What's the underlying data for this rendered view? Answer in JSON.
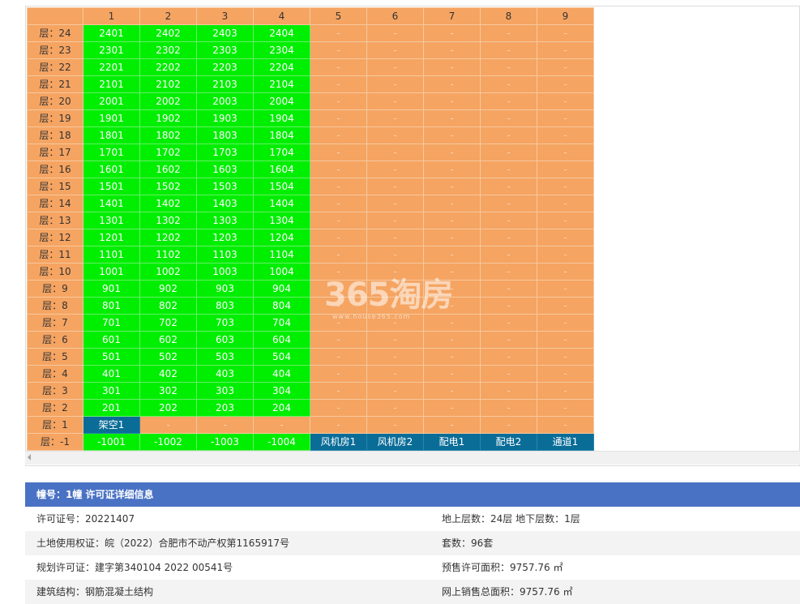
{
  "grid": {
    "columns": [
      "",
      "1",
      "2",
      "3",
      "4",
      "5",
      "6",
      "7",
      "8",
      "9"
    ],
    "rows": [
      {
        "floor": "层：24",
        "units": [
          "2401",
          "2402",
          "2403",
          "2404",
          "-",
          "-",
          "-",
          "-",
          "-"
        ],
        "kind": [
          "sold",
          "sold",
          "sold",
          "sold",
          "empty",
          "empty",
          "empty",
          "empty",
          "empty"
        ]
      },
      {
        "floor": "层：23",
        "units": [
          "2301",
          "2302",
          "2303",
          "2304",
          "-",
          "-",
          "-",
          "-",
          "-"
        ],
        "kind": [
          "sold",
          "sold",
          "sold",
          "sold",
          "empty",
          "empty",
          "empty",
          "empty",
          "empty"
        ]
      },
      {
        "floor": "层：22",
        "units": [
          "2201",
          "2202",
          "2203",
          "2204",
          "-",
          "-",
          "-",
          "-",
          "-"
        ],
        "kind": [
          "sold",
          "sold",
          "sold",
          "sold",
          "empty",
          "empty",
          "empty",
          "empty",
          "empty"
        ]
      },
      {
        "floor": "层：21",
        "units": [
          "2101",
          "2102",
          "2103",
          "2104",
          "-",
          "-",
          "-",
          "-",
          "-"
        ],
        "kind": [
          "sold",
          "sold",
          "sold",
          "sold",
          "empty",
          "empty",
          "empty",
          "empty",
          "empty"
        ]
      },
      {
        "floor": "层：20",
        "units": [
          "2001",
          "2002",
          "2003",
          "2004",
          "-",
          "-",
          "-",
          "-",
          "-"
        ],
        "kind": [
          "sold",
          "sold",
          "sold",
          "sold",
          "empty",
          "empty",
          "empty",
          "empty",
          "empty"
        ]
      },
      {
        "floor": "层：19",
        "units": [
          "1901",
          "1902",
          "1903",
          "1904",
          "-",
          "-",
          "-",
          "-",
          "-"
        ],
        "kind": [
          "sold",
          "sold",
          "sold",
          "sold",
          "empty",
          "empty",
          "empty",
          "empty",
          "empty"
        ]
      },
      {
        "floor": "层：18",
        "units": [
          "1801",
          "1802",
          "1803",
          "1804",
          "-",
          "-",
          "-",
          "-",
          "-"
        ],
        "kind": [
          "sold",
          "sold",
          "sold",
          "sold",
          "empty",
          "empty",
          "empty",
          "empty",
          "empty"
        ]
      },
      {
        "floor": "层：17",
        "units": [
          "1701",
          "1702",
          "1703",
          "1704",
          "-",
          "-",
          "-",
          "-",
          "-"
        ],
        "kind": [
          "sold",
          "sold",
          "sold",
          "sold",
          "empty",
          "empty",
          "empty",
          "empty",
          "empty"
        ]
      },
      {
        "floor": "层：16",
        "units": [
          "1601",
          "1602",
          "1603",
          "1604",
          "-",
          "-",
          "-",
          "-",
          "-"
        ],
        "kind": [
          "sold",
          "sold",
          "sold",
          "sold",
          "empty",
          "empty",
          "empty",
          "empty",
          "empty"
        ]
      },
      {
        "floor": "层：15",
        "units": [
          "1501",
          "1502",
          "1503",
          "1504",
          "-",
          "-",
          "-",
          "-",
          "-"
        ],
        "kind": [
          "sold",
          "sold",
          "sold",
          "sold",
          "empty",
          "empty",
          "empty",
          "empty",
          "empty"
        ]
      },
      {
        "floor": "层：14",
        "units": [
          "1401",
          "1402",
          "1403",
          "1404",
          "-",
          "-",
          "-",
          "-",
          "-"
        ],
        "kind": [
          "sold",
          "sold",
          "sold",
          "sold",
          "empty",
          "empty",
          "empty",
          "empty",
          "empty"
        ]
      },
      {
        "floor": "层：13",
        "units": [
          "1301",
          "1302",
          "1303",
          "1304",
          "-",
          "-",
          "-",
          "-",
          "-"
        ],
        "kind": [
          "sold",
          "sold",
          "sold",
          "sold",
          "empty",
          "empty",
          "empty",
          "empty",
          "empty"
        ]
      },
      {
        "floor": "层：12",
        "units": [
          "1201",
          "1202",
          "1203",
          "1204",
          "-",
          "-",
          "-",
          "-",
          "-"
        ],
        "kind": [
          "sold",
          "sold",
          "sold",
          "sold",
          "empty",
          "empty",
          "empty",
          "empty",
          "empty"
        ]
      },
      {
        "floor": "层：11",
        "units": [
          "1101",
          "1102",
          "1103",
          "1104",
          "-",
          "-",
          "-",
          "-",
          "-"
        ],
        "kind": [
          "sold",
          "sold",
          "sold",
          "sold",
          "empty",
          "empty",
          "empty",
          "empty",
          "empty"
        ]
      },
      {
        "floor": "层：10",
        "units": [
          "1001",
          "1002",
          "1003",
          "1004",
          "-",
          "-",
          "-",
          "-",
          "-"
        ],
        "kind": [
          "sold",
          "sold",
          "sold",
          "sold",
          "empty",
          "empty",
          "empty",
          "empty",
          "empty"
        ]
      },
      {
        "floor": "层：9",
        "units": [
          "901",
          "902",
          "903",
          "904",
          "-",
          "-",
          "-",
          "-",
          "-"
        ],
        "kind": [
          "sold",
          "sold",
          "sold",
          "sold",
          "empty",
          "empty",
          "empty",
          "empty",
          "empty"
        ]
      },
      {
        "floor": "层：8",
        "units": [
          "801",
          "802",
          "803",
          "804",
          "-",
          "-",
          "-",
          "-",
          "-"
        ],
        "kind": [
          "sold",
          "sold",
          "sold",
          "sold",
          "empty",
          "empty",
          "empty",
          "empty",
          "empty"
        ]
      },
      {
        "floor": "层：7",
        "units": [
          "701",
          "702",
          "703",
          "704",
          "-",
          "-",
          "-",
          "-",
          "-"
        ],
        "kind": [
          "sold",
          "sold",
          "sold",
          "sold",
          "empty",
          "empty",
          "empty",
          "empty",
          "empty"
        ]
      },
      {
        "floor": "层：6",
        "units": [
          "601",
          "602",
          "603",
          "604",
          "-",
          "-",
          "-",
          "-",
          "-"
        ],
        "kind": [
          "sold",
          "sold",
          "sold",
          "sold",
          "empty",
          "empty",
          "empty",
          "empty",
          "empty"
        ]
      },
      {
        "floor": "层：5",
        "units": [
          "501",
          "502",
          "503",
          "504",
          "-",
          "-",
          "-",
          "-",
          "-"
        ],
        "kind": [
          "sold",
          "sold",
          "sold",
          "sold",
          "empty",
          "empty",
          "empty",
          "empty",
          "empty"
        ]
      },
      {
        "floor": "层：4",
        "units": [
          "401",
          "402",
          "403",
          "404",
          "-",
          "-",
          "-",
          "-",
          "-"
        ],
        "kind": [
          "sold",
          "sold",
          "sold",
          "sold",
          "empty",
          "empty",
          "empty",
          "empty",
          "empty"
        ]
      },
      {
        "floor": "层：3",
        "units": [
          "301",
          "302",
          "303",
          "304",
          "-",
          "-",
          "-",
          "-",
          "-"
        ],
        "kind": [
          "sold",
          "sold",
          "sold",
          "sold",
          "empty",
          "empty",
          "empty",
          "empty",
          "empty"
        ]
      },
      {
        "floor": "层：2",
        "units": [
          "201",
          "202",
          "203",
          "204",
          "-",
          "-",
          "-",
          "-",
          "-"
        ],
        "kind": [
          "sold",
          "sold",
          "sold",
          "sold",
          "empty",
          "empty",
          "empty",
          "empty",
          "empty"
        ]
      },
      {
        "floor": "层：1",
        "units": [
          "架空1",
          "-",
          "-",
          "-",
          "-",
          "-",
          "-",
          "-",
          "-"
        ],
        "kind": [
          "special",
          "empty",
          "empty",
          "empty",
          "empty",
          "empty",
          "empty",
          "empty",
          "empty"
        ]
      },
      {
        "floor": "层：-1",
        "units": [
          "-1001",
          "-1002",
          "-1003",
          "-1004",
          "风机房1",
          "风机房2",
          "配电1",
          "配电2",
          "通道1"
        ],
        "kind": [
          "sold",
          "sold",
          "sold",
          "sold",
          "special",
          "special",
          "special",
          "special",
          "special"
        ]
      }
    ]
  },
  "colors": {
    "available": "#f5a462",
    "sold": "#00ee00",
    "special": "#0a6d98",
    "info_header": "#4a72c4"
  },
  "watermark": {
    "main": "365淘房",
    "sub": "www.house365.com"
  },
  "info": {
    "header": "幢号：1幢 许可证详细信息",
    "rows": [
      {
        "left": "许可证号：20221407",
        "right": "地上层数：24层  地下层数：1层"
      },
      {
        "left": "土地使用权证：皖（2022）合肥市不动产权第1165917号",
        "right": "套数：96套"
      },
      {
        "left": "规划许可证：建字第340104 2022 00541号",
        "right": "预售许可面积：9757.76 ㎡"
      },
      {
        "left": "建筑结构：钢筋混凝土结构",
        "right": "网上销售总面积：9757.76 ㎡"
      }
    ]
  }
}
